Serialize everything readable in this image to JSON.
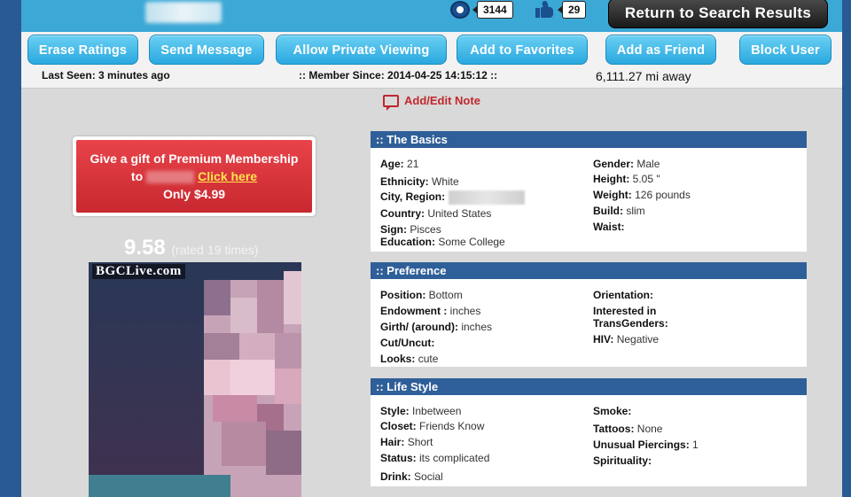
{
  "topbar": {
    "views_count": "3144",
    "likes_count": "29",
    "return_label": "Return to Search Results"
  },
  "actions": {
    "erase": "Erase Ratings",
    "message": "Send Message",
    "private": "Allow Private Viewing",
    "favorites": "Add to Favorites",
    "friend": "Add as Friend",
    "block": "Block User"
  },
  "meta": {
    "last_seen": "Last Seen: 3 minutes ago",
    "member_since": ":: Member Since: 2014-04-25 14:15:12 ::",
    "distance": "6,111.27 mi away"
  },
  "note": {
    "label": "Add/Edit Note"
  },
  "gift": {
    "line1": "Give a gift of Premium Membership",
    "to": "to",
    "link": "Click here",
    "price": "Only $4.99"
  },
  "rating": {
    "score": "9.58",
    "sub": "(rated 19 times)"
  },
  "photo": {
    "watermark": "BGCLive.com"
  },
  "basics": {
    "title": ":: The Basics",
    "age_label": "Age:",
    "age": "21",
    "ethnicity_label": "Ethnicity:",
    "ethnicity": "White",
    "city_label": "City, Region:",
    "country_label": "Country:",
    "country": "United States",
    "sign_label": "Sign:",
    "sign": "Pisces",
    "education_label": "Education:",
    "education": "Some College",
    "gender_label": "Gender:",
    "gender": "Male",
    "height_label": "Height:",
    "height": "5.05 \"",
    "weight_label": "Weight:",
    "weight": "126 pounds",
    "build_label": "Build:",
    "build": "slim",
    "waist_label": "Waist:"
  },
  "preference": {
    "title": ":: Preference",
    "position_label": "Position:",
    "position": "Bottom",
    "endowment_label": "Endowment :",
    "endowment": "inches",
    "girth_label": "Girth/ (around):",
    "girth": "inches",
    "cut_label": "Cut/Uncut:",
    "looks_label": "Looks:",
    "looks": "cute",
    "orientation_label": "Orientation:",
    "interested_label1": "Interested in",
    "interested_label2": "TransGenders:",
    "hiv_label": "HIV:",
    "hiv": "Negative"
  },
  "lifestyle": {
    "title": ":: Life Style",
    "style_label": "Style:",
    "style": "Inbetween",
    "closet_label": "Closet:",
    "closet": "Friends Know",
    "hair_label": "Hair:",
    "hair": "Short",
    "status_label": "Status:",
    "status": "its complicated",
    "drink_label": "Drink:",
    "drink": "Social",
    "smoke_label": "Smoke:",
    "tattoos_label": "Tattoos:",
    "tattoos": "None",
    "piercings_label": "Unusual Piercings:",
    "piercings": "1",
    "spirituality_label": "Spirituality:"
  }
}
